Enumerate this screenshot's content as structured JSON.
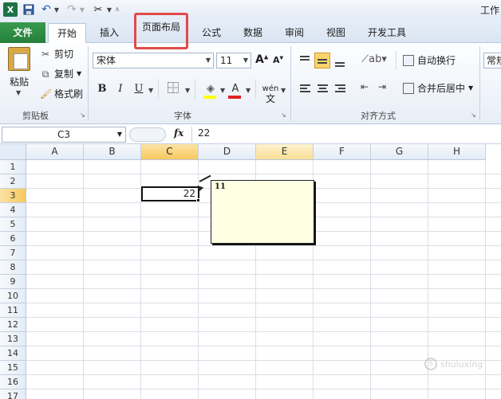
{
  "title_bar": {
    "app_icon_text": "X",
    "window_title": "工作"
  },
  "tabs": {
    "file": "文件",
    "home": "开始",
    "insert": "插入",
    "page_layout": "页面布局",
    "formulas": "公式",
    "data": "数据",
    "review": "审阅",
    "view": "视图",
    "developer": "开发工具"
  },
  "clipboard": {
    "paste": "粘贴",
    "cut": "剪切",
    "copy": "复制",
    "format_painter": "格式刷",
    "group_label": "剪贴板"
  },
  "font": {
    "name": "宋体",
    "size": "11",
    "bold": "B",
    "italic": "I",
    "underline": "U",
    "phonetic": "wén",
    "group_label": "字体",
    "fill_color": "#ffff00",
    "font_color": "#e02020"
  },
  "alignment": {
    "wrap_text": "自动换行",
    "merge_center": "合并后居中",
    "group_label": "对齐方式"
  },
  "number": {
    "format": "常规"
  },
  "formula_bar": {
    "name_box": "C3",
    "fx": "fx",
    "value": "22"
  },
  "grid": {
    "columns": [
      "A",
      "B",
      "C",
      "D",
      "E",
      "F",
      "G",
      "H"
    ],
    "rows": [
      "1",
      "2",
      "3",
      "4",
      "5",
      "6",
      "7",
      "8",
      "9",
      "10",
      "11",
      "12",
      "13",
      "14",
      "15",
      "16",
      "17"
    ],
    "cell_c3": "22",
    "comment_text": "11"
  },
  "watermark": {
    "text": "shuluxing"
  }
}
